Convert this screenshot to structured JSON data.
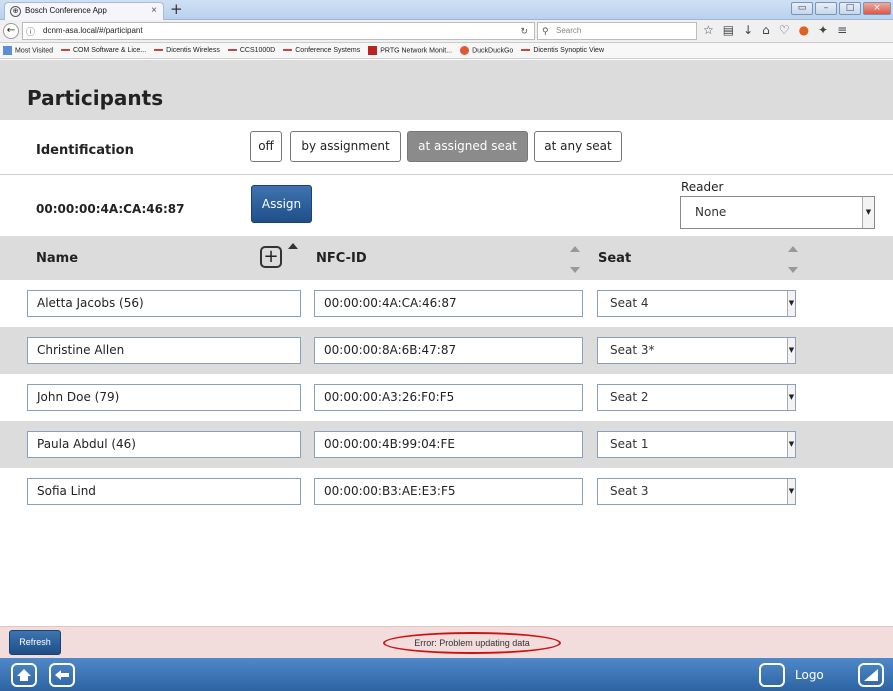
{
  "browser": {
    "tab_title": "Bosch Conference App",
    "tab_favicon": "⊕",
    "new_tab": "+",
    "url": "dcnm-asa.local/#/participant",
    "search_placeholder": "Search",
    "bookmarks": [
      {
        "label": "Most Visited",
        "icon": "bookmark-folder-icon"
      },
      {
        "label": "COM Software & Lice...",
        "icon": "bookmark-icon"
      },
      {
        "label": "Dicentis Wireless",
        "icon": "bookmark-icon"
      },
      {
        "label": "CCS1000D",
        "icon": "bookmark-icon"
      },
      {
        "label": "Conference Systems",
        "icon": "bookmark-icon"
      },
      {
        "label": "PRTG Network Monit...",
        "icon": "prtg-icon"
      },
      {
        "label": "DuckDuckGo",
        "icon": "duckduckgo-icon"
      },
      {
        "label": "Dicentis Synoptic View",
        "icon": "bookmark-icon"
      }
    ]
  },
  "page": {
    "title": "Participants"
  },
  "identification": {
    "label": "Identification",
    "options": [
      {
        "label": "off",
        "active": false
      },
      {
        "label": "by assignment",
        "active": false
      },
      {
        "label": "at assigned seat",
        "active": true
      },
      {
        "label": "at any seat",
        "active": false
      }
    ]
  },
  "assign": {
    "nfc_value": "00:00:00:4A:CA:46:87",
    "button_label": "Assign",
    "reader_label": "Reader",
    "reader_value": "None"
  },
  "table": {
    "columns": {
      "name": "Name",
      "nfc": "NFC-ID",
      "seat": "Seat"
    },
    "rows": [
      {
        "name": "Aletta Jacobs (56)",
        "nfc": "00:00:00:4A:CA:46:87",
        "seat": "Seat 4"
      },
      {
        "name": "Christine Allen",
        "nfc": "00:00:00:8A:6B:47:87",
        "seat": "Seat 3*"
      },
      {
        "name": "John Doe (79)",
        "nfc": "00:00:00:A3:26:F0:F5",
        "seat": "Seat 2"
      },
      {
        "name": "Paula Abdul (46)",
        "nfc": "00:00:00:4B:99:04:FE",
        "seat": "Seat 1"
      },
      {
        "name": "Sofia Lind",
        "nfc": "00:00:00:B3:AE:E3:F5",
        "seat": "Seat 3"
      }
    ]
  },
  "status": {
    "refresh_label": "Refresh",
    "error_text": "Error: Problem updating data",
    "error_color": "#cc1111"
  },
  "bottom": {
    "logo_label": "Logo"
  },
  "colors": {
    "primary_button": "#2a5f9e",
    "header_bg": "#dcdcdc",
    "active_segment": "#8b8b8b",
    "error_bar": "#f2dcdc",
    "bottom_bar": "#3b74b5"
  }
}
